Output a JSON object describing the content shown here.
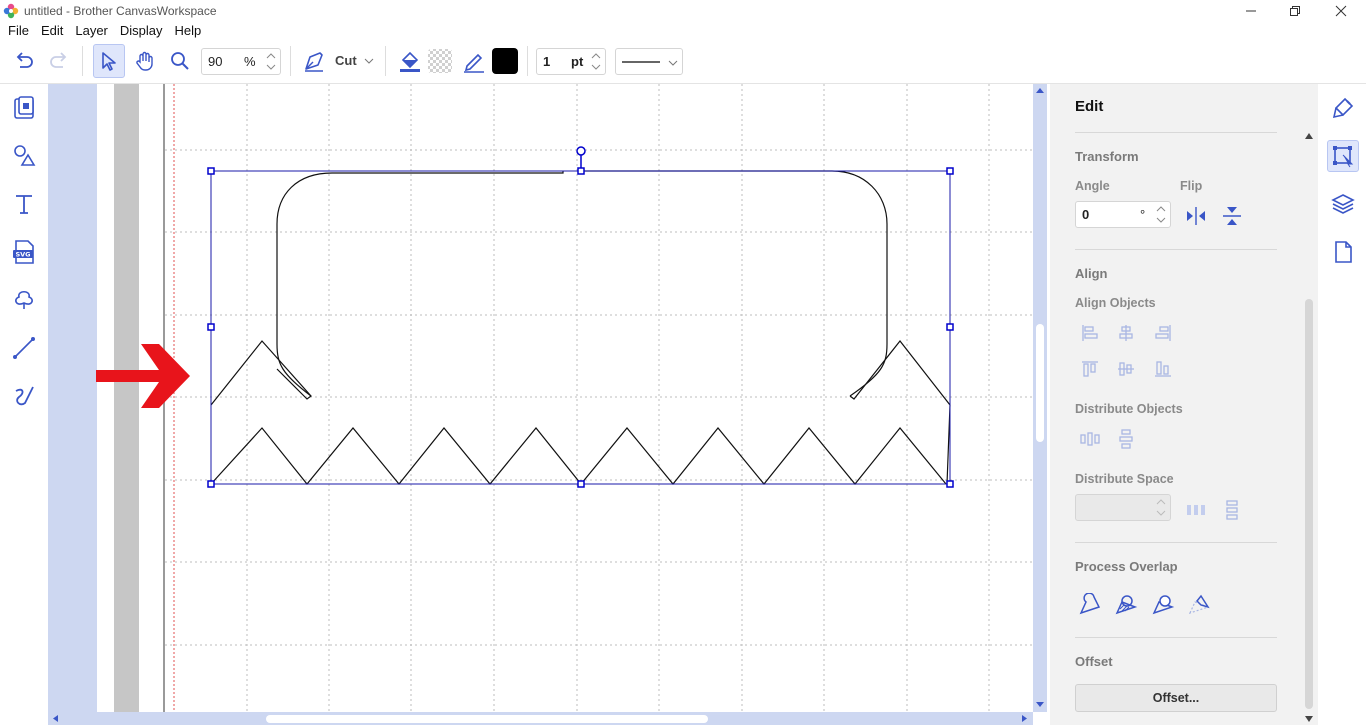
{
  "window": {
    "title": "untitled - Brother CanvasWorkspace"
  },
  "menu": [
    "File",
    "Edit",
    "Layer",
    "Display",
    "Help"
  ],
  "toolbar": {
    "zoom_value": "90",
    "zoom_unit": "%",
    "mode_label": "Cut",
    "line_width_value": "1",
    "line_width_unit": "pt",
    "line_color": "#000000"
  },
  "edit_panel": {
    "title": "Edit",
    "transform": {
      "heading": "Transform",
      "angle_label": "Angle",
      "angle_value": "0",
      "angle_unit": "°",
      "flip_label": "Flip"
    },
    "align": {
      "heading": "Align",
      "align_objects_label": "Align Objects",
      "distribute_objects_label": "Distribute Objects",
      "distribute_space_label": "Distribute Space",
      "distribute_space_value": ""
    },
    "process_overlap": {
      "heading": "Process Overlap"
    },
    "offset": {
      "heading": "Offset",
      "button_label": "Offset..."
    }
  },
  "colors": {
    "accent": "#3a56c7",
    "selection": "#0000cc",
    "arrow": "#e8141b",
    "canvas_bg": "#cdd7f1",
    "panel_bg": "#f2f2f2"
  }
}
